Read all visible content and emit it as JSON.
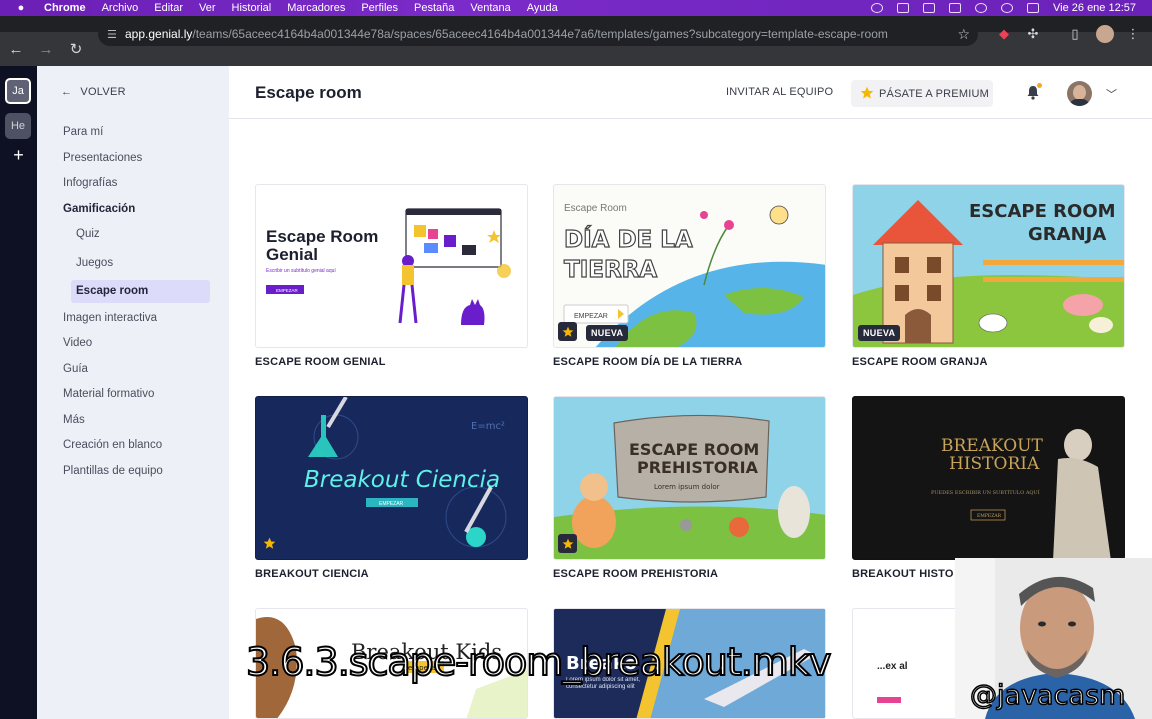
{
  "menubar": {
    "app_name": "Chrome",
    "items": [
      "Archivo",
      "Editar",
      "Ver",
      "Historial",
      "Marcadores",
      "Perfiles",
      "Pestaña",
      "Ventana",
      "Ayuda"
    ],
    "clock": "Vie 26 ene  12:57"
  },
  "browser": {
    "url_host": "app.genial.ly",
    "url_path": "/teams/65aceec4164b4a001344e78a/spaces/65aceec4164b4a001344e7a6/templates/games?subcategory=template-escape-room"
  },
  "rail": {
    "workspaces": [
      "Ja",
      "He"
    ],
    "add": "+"
  },
  "sidebar": {
    "back_label": "VOLVER",
    "items": [
      {
        "label": "Para mí"
      },
      {
        "label": "Presentaciones"
      },
      {
        "label": "Infografías"
      },
      {
        "label": "Gamificación"
      },
      {
        "label": "Quiz"
      },
      {
        "label": "Juegos"
      },
      {
        "label": "Escape room"
      },
      {
        "label": "Imagen interactiva"
      },
      {
        "label": "Video"
      },
      {
        "label": "Guía"
      },
      {
        "label": "Material formativo"
      },
      {
        "label": "Más"
      },
      {
        "label": "Creación en blanco"
      },
      {
        "label": "Plantillas de equipo"
      }
    ]
  },
  "header": {
    "invite_label": "INVITAR AL EQUIPO",
    "premium_label": "PÁSATE A PREMIUM",
    "accent": "#f5b800"
  },
  "main": {
    "title": "Escape room",
    "badge_new": "NUEVA",
    "cards": [
      {
        "label": "ESCAPE ROOM GENIAL",
        "title_line1": "Escape Room",
        "title_line2": "Genial",
        "subtitle": "Escribir un subtítulo genial aquí",
        "button": "EMPEZAR"
      },
      {
        "label": "ESCAPE ROOM DÍA DE LA TIERRA",
        "kicker": "Escape Room",
        "title_line1": "DÍA DE LA",
        "title_line2": "TIERRA",
        "button": "EMPEZAR"
      },
      {
        "label": "ESCAPE ROOM GRANJA",
        "title_line1": "ESCAPE ROOM",
        "title_line2": "GRANJA"
      },
      {
        "label": "BREAKOUT CIENCIA",
        "title": "Breakout Ciencia",
        "button": "EMPEZAR",
        "formula": "E=mc²"
      },
      {
        "label": "ESCAPE ROOM PREHISTORIA",
        "title_line1": "ESCAPE ROOM",
        "title_line2": "PREHISTORIA",
        "subtitle": "Lorem ipsum dolor"
      },
      {
        "label": "BREAKOUT HISTORIA",
        "title_line1": "BREAKOUT",
        "title_line2": "HISTORIA",
        "subtitle": "PUEDES ESCRIBIR UN SUBTÍTULO AQUÍ",
        "button": "EMPEZAR"
      },
      {
        "title": "Breakout Kids",
        "button": "empezar"
      },
      {
        "title": "Breako",
        "body": "Lorem ipsum dolor sit amet, consectetur adipiscing elit"
      },
      {
        "title": "...ex al"
      }
    ]
  },
  "overlay": {
    "caption": "3.6.3.scape-room_breakout.mkv",
    "handle": "@javacasm"
  }
}
